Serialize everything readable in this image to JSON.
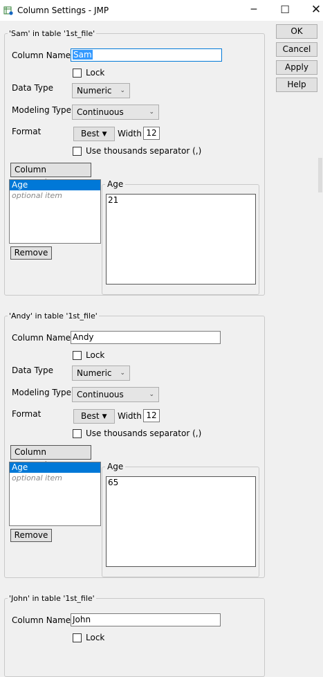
{
  "window": {
    "title": "Column Settings - JMP",
    "minimize": "─",
    "maximize": "☐",
    "close": "✕"
  },
  "side_buttons": {
    "ok": "OK",
    "cancel": "Cancel",
    "apply": "Apply",
    "help": "Help"
  },
  "labels": {
    "column_name": "Column Name",
    "lock": "Lock",
    "data_type": "Data Type",
    "modeling_type": "Modeling Type",
    "format": "Format",
    "width": "Width",
    "thousands": "Use thousands separator (,)",
    "column_properties": "Column Properties",
    "remove": "Remove",
    "optional_item": "optional item",
    "property_name": "Age"
  },
  "columns": [
    {
      "legend": "'Sam' in table '1st_file'",
      "name": "Sam",
      "data_type": "Numeric",
      "modeling_type": "Continuous",
      "format": "Best",
      "width": "12",
      "property": "Age",
      "age_value": "21"
    },
    {
      "legend": "'Andy' in table '1st_file'",
      "name": "Andy",
      "data_type": "Numeric",
      "modeling_type": "Continuous",
      "format": "Best",
      "width": "12",
      "property": "Age",
      "age_value": "65"
    },
    {
      "legend": "'John' in table '1st_file'",
      "name": "John"
    }
  ]
}
